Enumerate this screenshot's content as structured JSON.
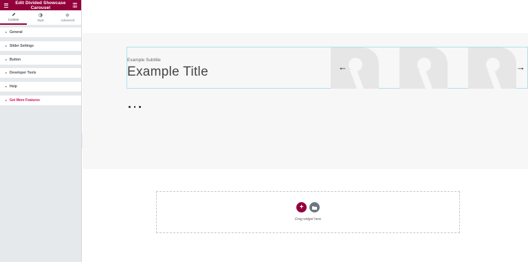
{
  "header": {
    "title": "Edit Divided Showcase Carousel",
    "menu_icon": "hamburger-icon",
    "grid_icon": "apps-grid-icon"
  },
  "tabs": [
    {
      "label": "Content",
      "icon": "pencil-icon",
      "active": true
    },
    {
      "label": "Style",
      "icon": "half-circle-icon",
      "active": false
    },
    {
      "label": "Advanced",
      "icon": "gear-icon",
      "active": false
    }
  ],
  "sections": [
    {
      "label": "General"
    },
    {
      "label": "Slider Settings"
    },
    {
      "label": "Button"
    },
    {
      "label": "Developer Tools"
    },
    {
      "label": "Help"
    },
    {
      "label": "Get More Features"
    }
  ],
  "colors": {
    "brand": "#93003c",
    "promo": "#d30c5c",
    "panel": "#e6e9ec",
    "selection": "#aee0f0"
  },
  "slide": {
    "subtitle": "Example Subtitle",
    "title": "Example Title"
  },
  "carousel": {
    "prev_icon": "arrow-left-icon",
    "next_icon": "arrow-right-icon",
    "dot_count": 3
  },
  "dropzone": {
    "label": "Drag widget here",
    "add_icon": "plus-icon",
    "folder_icon": "folder-icon"
  }
}
